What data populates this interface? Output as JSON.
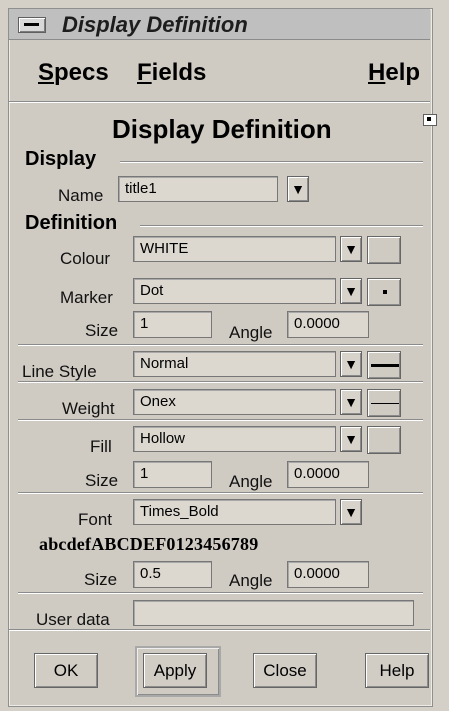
{
  "window": {
    "title": "Display Definition"
  },
  "menu": {
    "specs": "Specs",
    "fields": "Fields",
    "help": "Help"
  },
  "dialog": {
    "header": "Display Definition"
  },
  "display": {
    "section": "Display",
    "name_label": "Name",
    "name_value": "title1"
  },
  "definition": {
    "section": "Definition",
    "colour_label": "Colour",
    "colour_value": "WHITE",
    "marker_label": "Marker",
    "marker_value": "Dot",
    "marker_size_label": "Size",
    "marker_size_value": "1",
    "marker_angle_label": "Angle",
    "marker_angle_value": "0.0000",
    "line_style_label": "Line Style",
    "line_style_value": "Normal",
    "weight_label": "Weight",
    "weight_value": "Onex",
    "fill_label": "Fill",
    "fill_value": "Hollow",
    "fill_size_label": "Size",
    "fill_size_value": "1",
    "fill_angle_label": "Angle",
    "fill_angle_value": "0.0000",
    "font_label": "Font",
    "font_value": "Times_Bold",
    "font_preview": "abcdefABCDEF0123456789",
    "font_size_label": "Size",
    "font_size_value": "0.5",
    "font_angle_label": "Angle",
    "font_angle_value": "0.0000",
    "user_data_label": "User data",
    "user_data_value": ""
  },
  "buttons": {
    "ok": "OK",
    "apply": "Apply",
    "close": "Close",
    "help": "Help"
  },
  "icons": {
    "system_menu": "system-menu-icon",
    "maximize": "maximize-icon",
    "dropdown": "dropdown-arrow-icon"
  }
}
